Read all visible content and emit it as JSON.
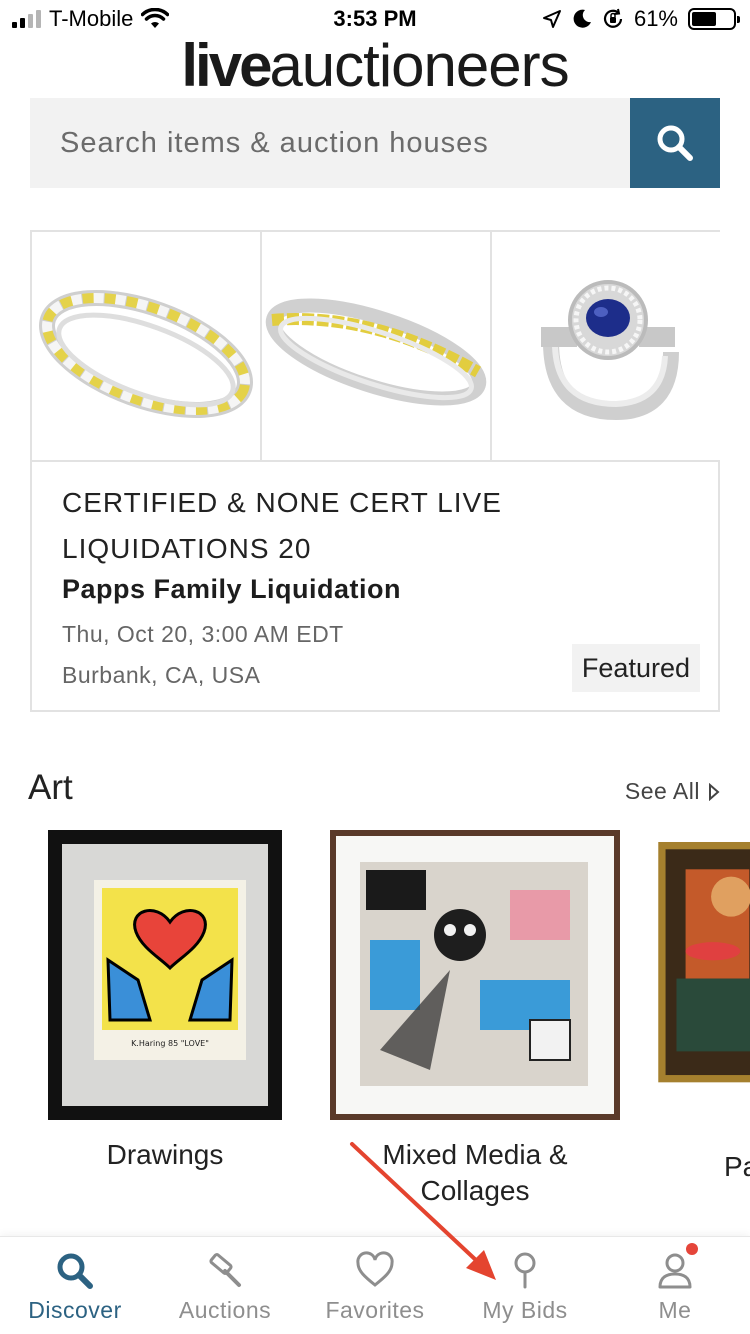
{
  "status_bar": {
    "carrier": "T-Mobile",
    "time": "3:53 PM",
    "battery": "61%",
    "icons": [
      "signal-icon",
      "wifi-icon",
      "location-icon",
      "moon-icon",
      "rotation-lock-icon",
      "battery-icon"
    ]
  },
  "logo": {
    "bold": "live",
    "light": "auctioneers"
  },
  "search": {
    "placeholder": "Search items & auction houses",
    "button_icon": "search-icon"
  },
  "featured_auction": {
    "thumbnails": [
      "yellow-white-diamond-eternity-ring",
      "yellow-diamond-band-ring",
      "sapphire-halo-ring"
    ],
    "title_line1": "CERTIFIED & NONE CERT LIVE",
    "title_line2": "LIQUIDATIONS 20",
    "house": "Papps Family Liquidation",
    "date": "Thu, Oct 20, 3:00 AM EDT",
    "location": "Burbank, CA, USA",
    "badge": "Featured"
  },
  "art_section": {
    "title": "Art",
    "see_all": "See All",
    "categories": [
      {
        "label": "Drawings",
        "line2": ""
      },
      {
        "label": "Mixed Media &",
        "line2": "Collages"
      },
      {
        "label": "Pa",
        "line2": ""
      }
    ]
  },
  "bottom_nav": {
    "active": "Discover",
    "items": [
      {
        "label": "Discover",
        "icon": "search-icon"
      },
      {
        "label": "Auctions",
        "icon": "gavel-icon"
      },
      {
        "label": "Favorites",
        "icon": "heart-icon"
      },
      {
        "label": "My Bids",
        "icon": "paddle-icon"
      },
      {
        "label": "Me",
        "icon": "user-icon"
      }
    ]
  },
  "colors": {
    "accent": "#2c6282",
    "annotation_arrow": "#e4442f",
    "notification_dot": "#e5453a"
  }
}
